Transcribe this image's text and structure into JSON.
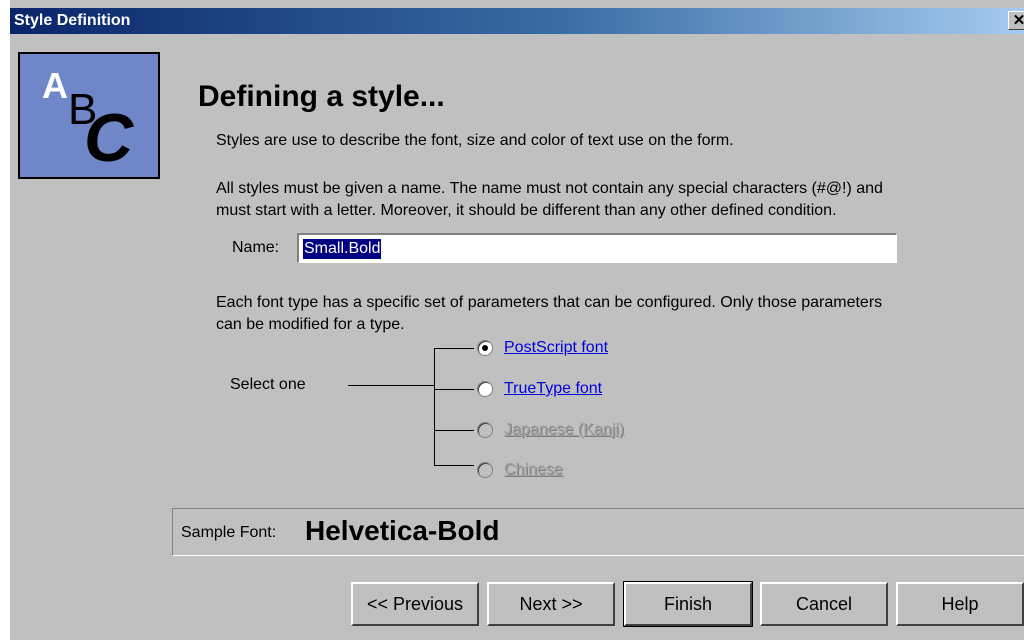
{
  "window": {
    "title": "Style Definition",
    "close_glyph": "✕"
  },
  "logo": {
    "letters": [
      "A",
      "B",
      "C"
    ],
    "icon": "abc-logo-icon"
  },
  "heading": "Defining a style...",
  "intro": "Styles are use to describe the font, size and color of text use on the form.",
  "name_help": [
    "All styles must be given a name. The name must not contain any special characters (#@!) and",
    "must start with a letter. Moreover, it should be different than any other defined condition."
  ],
  "name_field": {
    "label": "Name:",
    "value": "Small.Bold"
  },
  "font_help": [
    "Each font type has a specific set of parameters that can be configured. Only those parameters",
    "can be modified for a type."
  ],
  "font_type": {
    "prompt": "Select one",
    "options": [
      {
        "label": "PostScript font",
        "selected": true,
        "enabled": true
      },
      {
        "label": "TrueType font",
        "selected": false,
        "enabled": true
      },
      {
        "label": "Japanese (Kanji)",
        "selected": false,
        "enabled": false
      },
      {
        "label": "Chinese",
        "selected": false,
        "enabled": false
      }
    ]
  },
  "sample": {
    "label": "Sample Font:",
    "value": "Helvetica-Bold"
  },
  "buttons": {
    "previous": "<< Previous",
    "next": "Next >>",
    "finish": "Finish",
    "cancel": "Cancel",
    "help": "Help"
  },
  "colors": {
    "title_bar": "#0a246a",
    "link": "#0000e0",
    "selection": "#000080",
    "logo_bg": "#6f86c8"
  }
}
